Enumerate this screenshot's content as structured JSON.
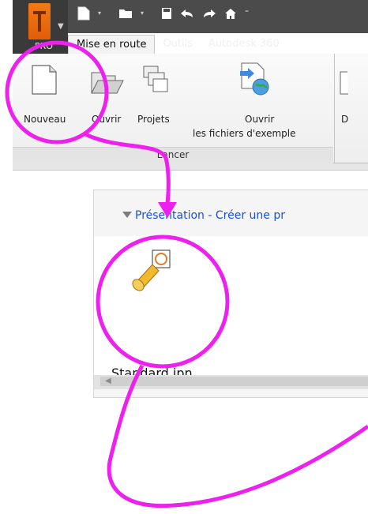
{
  "app": {
    "button_suffix": "PRO",
    "accent": "#ee6f12"
  },
  "qat": {
    "icons": [
      "new-doc-icon",
      "open-folder-icon",
      "save-icon",
      "undo-icon",
      "redo-icon",
      "home-icon",
      "customize-icon"
    ]
  },
  "tabs": [
    {
      "label": "Mise en route",
      "active": true
    },
    {
      "label": "Outils",
      "active": false
    },
    {
      "label": "Autodesk 360",
      "active": false
    }
  ],
  "ribbon": {
    "buttons": {
      "new": "Nouveau",
      "open": "Ouvrir",
      "projects": "Projets",
      "open_samples_line1": "Ouvrir",
      "open_samples_line2": "les fichiers d'exemple",
      "truncated": "D"
    },
    "panel_label": "Lancer"
  },
  "project_panel": {
    "section_header": "Présentation - Créer une pr",
    "file_label": "Standard.ipn"
  },
  "annotation": {
    "color": "#ee20ee"
  }
}
